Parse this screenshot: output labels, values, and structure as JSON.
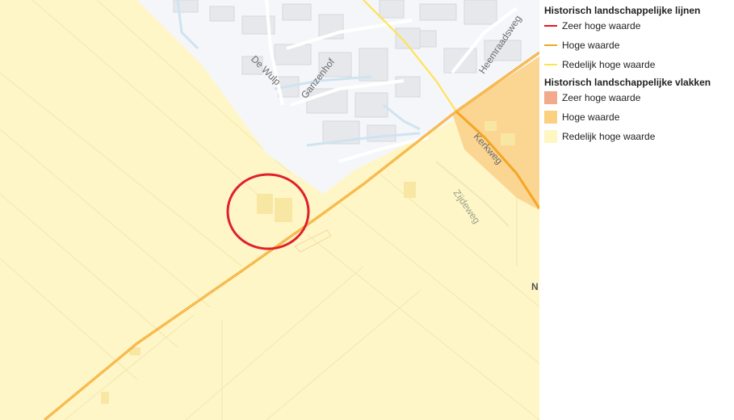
{
  "map": {
    "street_labels": {
      "de_wulp": "De Wulp",
      "ganzenhof": "Ganzenhof",
      "heemraadsweg": "Heemraadsweg",
      "kerkweg": "Kerkweg",
      "zijdeweg": "Zijdeweg",
      "edge_letter": "N"
    },
    "colors": {
      "background_plain": "#fff6c8",
      "urban_area": "#f4f6f9",
      "water": "#cfe3f0",
      "high_value_area": "#fbd592",
      "road_high_value": "#f5a623",
      "road_reasonable_value": "#ffe34a",
      "marker_circle": "#e0202a"
    }
  },
  "legend": {
    "lines_title": "Historisch landschappelijke lijnen",
    "lines": [
      {
        "label": "Zeer hoge waarde",
        "color": "#e31a1c"
      },
      {
        "label": "Hoge waarde",
        "color": "#f5a623"
      },
      {
        "label": "Redelijk hoge waarde",
        "color": "#ffe34a"
      }
    ],
    "areas_title": "Historisch landschappelijke vlakken",
    "areas": [
      {
        "label": "Zeer hoge waarde",
        "color": "#f2a98c"
      },
      {
        "label": "Hoge waarde",
        "color": "#fbd07f"
      },
      {
        "label": "Redelijk hoge waarde",
        "color": "#fff7c2"
      }
    ]
  }
}
